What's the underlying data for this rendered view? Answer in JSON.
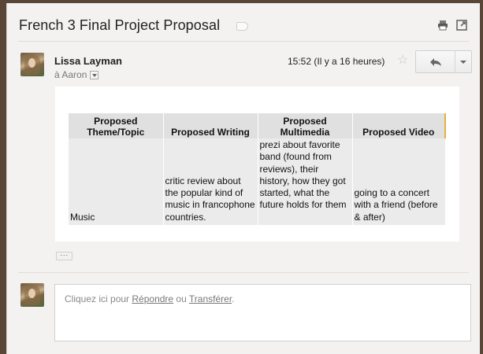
{
  "thread": {
    "subject": "French 3 Final Project Proposal",
    "label_icon": "label-tag-icon",
    "print_icon": "print-icon",
    "new_window_icon": "new-window-icon"
  },
  "message": {
    "sender": "Lissa Layman",
    "recipient": "à Aaron",
    "timestamp": "15:52 (Il y a 16 heures)",
    "star_icon": "star-icon",
    "reply_icon": "reply-icon",
    "more_icon": "chevron-down-icon",
    "table": {
      "headers": [
        "Proposed Theme/Topic",
        "Proposed Writing",
        "Proposed Multimedia",
        "Proposed Video"
      ],
      "rows": [
        {
          "topic": "Music",
          "writing": "critic review about the popular kind of music in francophone countries.",
          "multimedia": "prezi about favorite band (found from reviews), their history, how they got started, what the future holds for them",
          "video": "going to a concert with a friend (before & after)"
        }
      ]
    },
    "show_trimmed": "···"
  },
  "reply_box": {
    "prefix": "Cliquez ici pour ",
    "reply_link": "Répondre",
    "middle": " ou ",
    "forward_link": "Transférer",
    "suffix": "."
  },
  "colors": {
    "background": "#5a4636",
    "panel": "#f4f2f0",
    "table_header": "#e0e0e0",
    "table_cell": "#ebebeb",
    "header_accent": "#e8b040"
  }
}
